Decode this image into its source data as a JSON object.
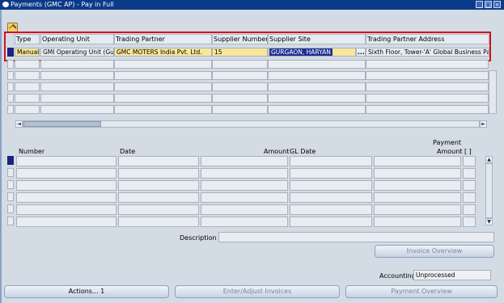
{
  "window": {
    "title": "Payments (GMC AP) - Pay in Full"
  },
  "top_grid": {
    "columns": [
      "Type",
      "Operating Unit",
      "Trading Partner",
      "Supplier Number",
      "Supplier Site",
      "Trading Partner Address"
    ],
    "active_row": {
      "type": "Manual",
      "operating_unit": "GMI Operating Unit (Gui",
      "trading_partner": "GMC MOTERS India Pvt. Ltd.",
      "supplier_number": "15",
      "supplier_site": "GURGAON, HARYAN",
      "trading_partner_address": "Sixth Floor, Tower-'A' Global Business Pa",
      "lov_button": "..."
    }
  },
  "bottom_grid": {
    "columns": [
      "Number",
      "Date",
      "Amount",
      "GL Date",
      "Payment Amount",
      "[ ]"
    ],
    "payment_label_line1": "Payment",
    "payment_label_line2": "Amount"
  },
  "description": {
    "label": "Description",
    "value": ""
  },
  "invoice_overview_button": "Invoice Overview",
  "accounting": {
    "label": "Accounting",
    "value": "Unprocessed"
  },
  "buttons": {
    "actions": "Actions... 1",
    "enter_adjust": "Enter/Adjust Invoices",
    "payment_overview": "Payment Overview"
  },
  "colors": {
    "title_bar": "#0b3a88",
    "highlight_border": "#d4121a",
    "required_field": "#f7e79a",
    "selected_field": "#1e2f91"
  }
}
